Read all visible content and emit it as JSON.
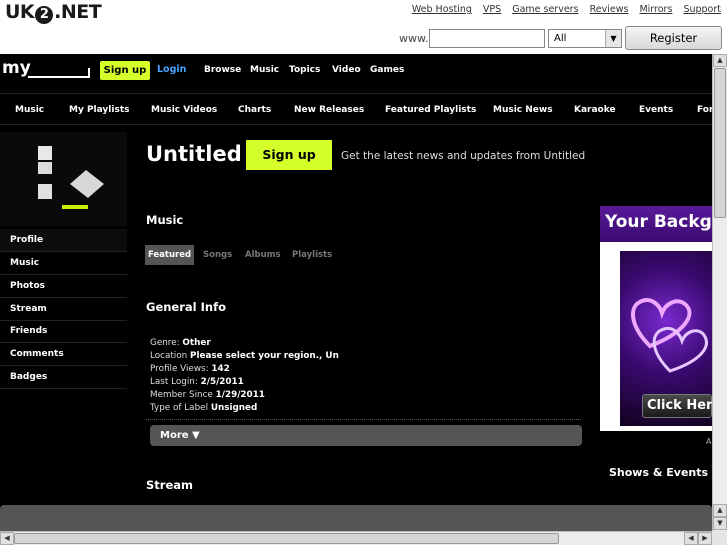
{
  "uk2": {
    "logo_left": "UK",
    "logo_two": "2",
    "logo_right": ".NET",
    "links": [
      "Web Hosting",
      "VPS",
      "Game servers",
      "Reviews",
      "Mirrors",
      "Support"
    ],
    "www_label": "www.",
    "domain_value": "",
    "tld_selected": "All",
    "register_label": "Register Domain"
  },
  "header": {
    "logo_text": "my",
    "signup_label": "Sign up",
    "login_label": "Login",
    "nav": [
      "Browse",
      "Music",
      "Topics",
      "Video",
      "Games"
    ]
  },
  "catnav": [
    "Music",
    "My Playlists",
    "Music Videos",
    "Charts",
    "New Releases",
    "Featured Playlists",
    "Music News",
    "Karaoke",
    "Events",
    "For"
  ],
  "sidebar": {
    "items": [
      "Profile",
      "Music",
      "Photos",
      "Stream",
      "Friends",
      "Comments",
      "Badges"
    ]
  },
  "profile": {
    "title": "Untitled",
    "signup_label": "Sign up",
    "tagline": "Get the latest news and updates from Untitled"
  },
  "music": {
    "heading": "Music",
    "tabs": [
      "Featured",
      "Songs",
      "Albums",
      "Playlists"
    ]
  },
  "general_info": {
    "heading": "General Info",
    "genre_label": "Genre:",
    "genre_value": "Other",
    "location_label": "Location",
    "location_value": "Please select your region., Un",
    "views_label": "Profile Views:",
    "views_value": "142",
    "last_login_label": "Last Login:",
    "last_login_value": "2/5/2011",
    "member_since_label": "Member Since",
    "member_since_value": "1/29/2011",
    "label_type_label": "Type of Label",
    "label_type_value": "Unsigned",
    "more_label": "More ▼"
  },
  "stream_heading": "Stream",
  "ad": {
    "headline": "Your Backg",
    "cta": "Click Here",
    "caption": "A"
  },
  "shows_heading": "Shows & Events",
  "colors": {
    "accent": "#d4ff2a",
    "link": "#4aa3ff",
    "background": "#000000"
  }
}
